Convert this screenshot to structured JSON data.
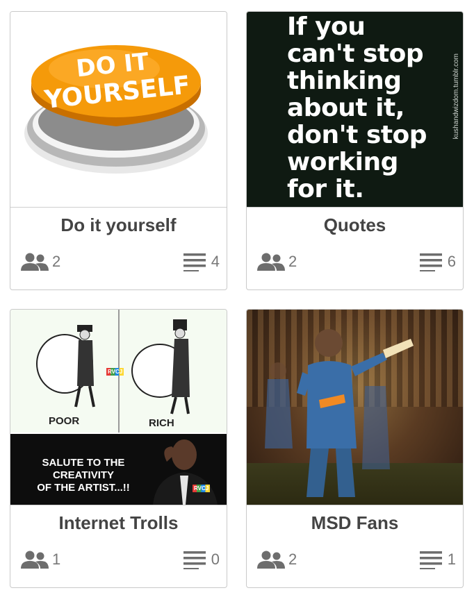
{
  "groups": [
    {
      "title": "Do it yourself",
      "members": "2",
      "posts": "4",
      "image": {
        "kind": "diy-button",
        "text_line1": "DO IT",
        "text_line2": "YOURSELF"
      }
    },
    {
      "title": "Quotes",
      "members": "2",
      "posts": "6",
      "image": {
        "kind": "quote",
        "lines": [
          "If you",
          "can't stop",
          "thinking",
          "about it,",
          "don't stop",
          "working",
          "for it."
        ],
        "side": "kushandwizdom.tumblr.com"
      }
    },
    {
      "title": "Internet Trolls",
      "members": "1",
      "posts": "0",
      "image": {
        "kind": "troll",
        "poor": "POOR",
        "rich": "RICH",
        "rvcj": "RVCJ",
        "salute_lines": [
          "SALUTE TO THE",
          "CREATIVITY",
          "OF THE ARTIST...!!"
        ]
      }
    },
    {
      "title": "MSD Fans",
      "members": "2",
      "posts": "1",
      "image": {
        "kind": "photo"
      }
    }
  ],
  "icons": {
    "members": "people-icon",
    "posts": "list-icon"
  },
  "colors": {
    "icon": "#6d6d6d",
    "title": "#444444",
    "count": "#777777",
    "border": "#c9c9c9"
  }
}
